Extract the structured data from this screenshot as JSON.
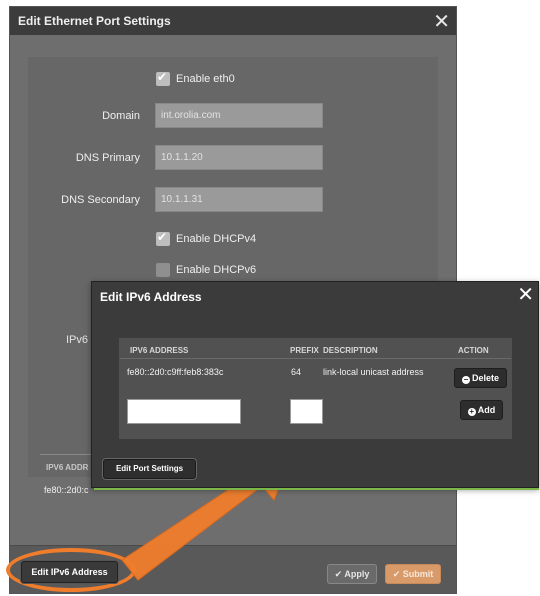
{
  "edit_port_dialog": {
    "title": "Edit Ethernet Port Settings",
    "close": "✕",
    "enable_eth0": {
      "label": "Enable eth0",
      "checked": true
    },
    "domain": {
      "label": "Domain",
      "value": "int.orolia.com"
    },
    "dns_primary": {
      "label": "DNS Primary",
      "value": "10.1.1.20"
    },
    "dns_secondary": {
      "label": "DNS Secondary",
      "value": "10.1.1.31"
    },
    "enable_dhcpv4": {
      "label": "Enable DHCPv4",
      "checked": true
    },
    "enable_dhcpv6": {
      "label": "Enable DHCPv6",
      "checked": false
    },
    "ipv6_label_partial": "IPv6",
    "ipv6_address_col_partial": "IPV6 ADDR",
    "ipv6_value_partial": "fe80::2d0:c",
    "apply_label": "Apply",
    "submit_label": "Submit",
    "edit_ipv6_label": "Edit IPv6 Address"
  },
  "edit_ipv6_dialog": {
    "title": "Edit IPv6 Address",
    "close": "✕",
    "columns": [
      "IPV6 ADDRESS",
      "PREFIX",
      "DESCRIPTION",
      "ACTION"
    ],
    "rows": [
      {
        "address": "fe80::2d0:c9ff:feb8:383c",
        "prefix": "64",
        "description": "link-local unicast address",
        "action": "Delete"
      }
    ],
    "new_row": {
      "address": "",
      "prefix": ""
    },
    "add_label": "Add",
    "edit_port_settings_label": "Edit Port Settings"
  },
  "colors": {
    "highlight": "#f07d2c",
    "accent_green": "#7ab648",
    "submit": "#d99a6a"
  }
}
